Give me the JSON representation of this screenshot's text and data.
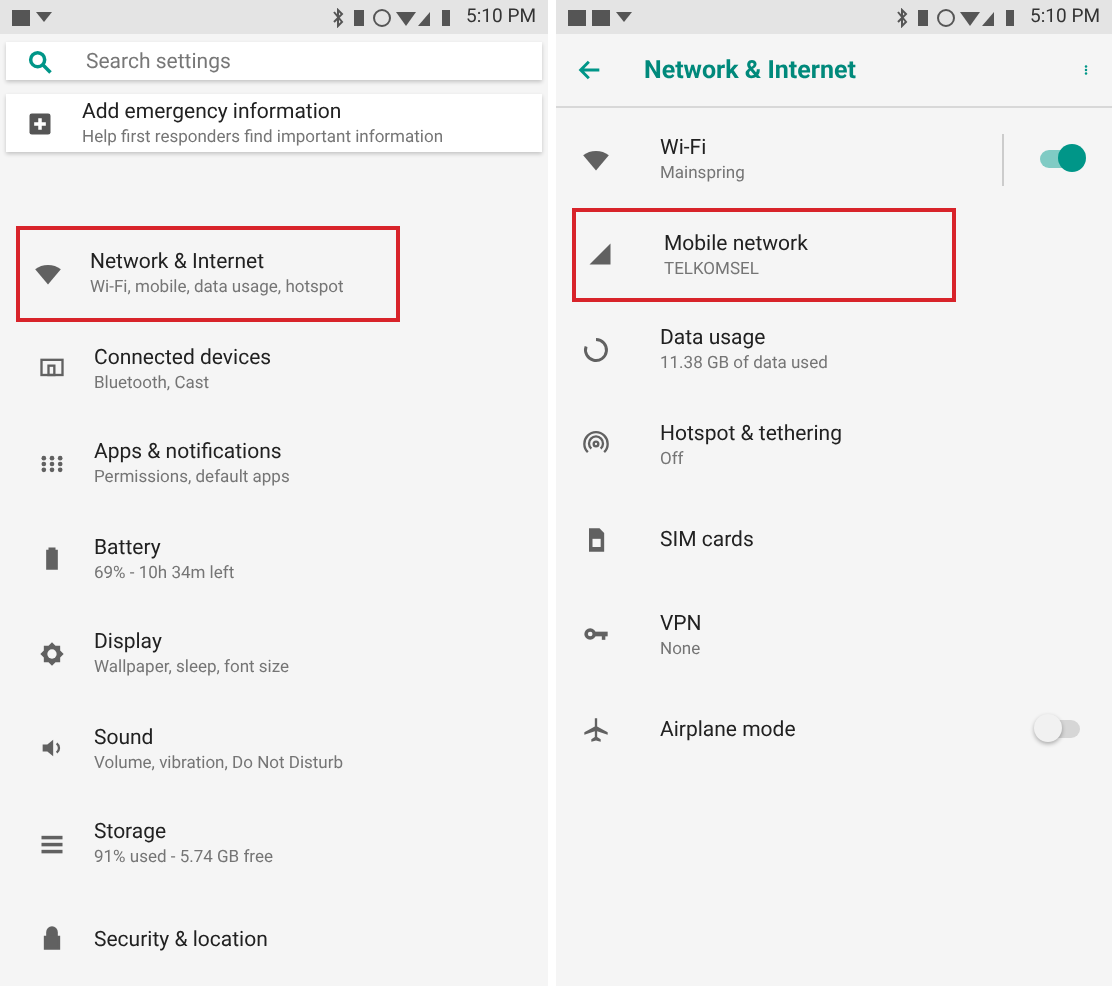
{
  "screens": [
    {
      "kind": "home",
      "status_bar": {
        "time": "5:10 PM"
      },
      "search": {
        "placeholder": "Search settings"
      },
      "suggestion": {
        "title": "Add emergency information",
        "subtitle": "Help first responders find important information"
      },
      "items": [
        {
          "title": "Network & Internet",
          "subtitle": "Wi-Fi, mobile, data usage, hotspot",
          "highlighted": true
        },
        {
          "title": "Connected devices",
          "subtitle": "Bluetooth, Cast",
          "highlighted": false
        },
        {
          "title": "Apps & notifications",
          "subtitle": "Permissions, default apps",
          "highlighted": false
        },
        {
          "title": "Battery",
          "subtitle": "69% - 10h 34m left",
          "highlighted": false
        },
        {
          "title": "Display",
          "subtitle": "Wallpaper, sleep, font size",
          "highlighted": false
        },
        {
          "title": "Sound",
          "subtitle": "Volume, vibration, Do Not Disturb",
          "highlighted": false
        },
        {
          "title": "Storage",
          "subtitle": "91% used - 5.74 GB free",
          "highlighted": false
        },
        {
          "title": "Security & location",
          "highlighted": false
        }
      ]
    },
    {
      "kind": "detail",
      "status_bar": {
        "time": "5:10 PM"
      },
      "toolbar": {
        "title": "Network & Internet"
      },
      "items": [
        {
          "kind": "toggle",
          "title": "Wi-Fi",
          "subtitle": "Mainspring",
          "on": true,
          "highlighted": false
        },
        {
          "kind": "link",
          "title": "Mobile network",
          "subtitle": "TELKOMSEL",
          "highlighted": true
        },
        {
          "kind": "link",
          "title": "Data usage",
          "subtitle": "11.38 GB of data used",
          "highlighted": false
        },
        {
          "kind": "link",
          "title": "Hotspot & tethering",
          "subtitle": "Off",
          "highlighted": false
        },
        {
          "kind": "link",
          "title": "SIM cards",
          "highlighted": false
        },
        {
          "kind": "link",
          "title": "VPN",
          "subtitle": "None",
          "highlighted": false
        },
        {
          "kind": "toggle",
          "title": "Airplane mode",
          "on": false,
          "highlighted": false
        }
      ]
    }
  ]
}
